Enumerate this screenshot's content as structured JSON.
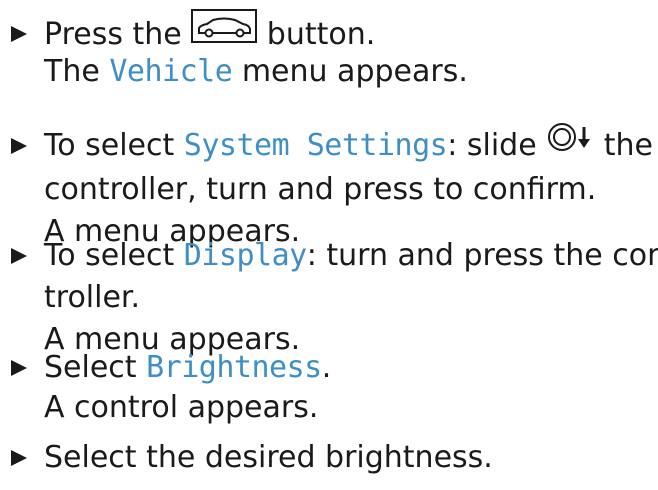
{
  "steps": [
    {
      "lines": [
        {
          "prefix": "Press the ",
          "icon": "car-icon",
          "suffix": " button."
        },
        {
          "text": "The ",
          "mono": "Vehicle",
          "after": " menu appears."
        }
      ]
    },
    {
      "lines": [
        {
          "text": "To select ",
          "mono": "System Settings",
          "after": ": slide ",
          "icon": "controller-slide-down-icon",
          "after2": " the"
        },
        {
          "text": "controller, turn and press to confirm."
        },
        {
          "text": "A menu appears."
        }
      ]
    },
    {
      "lines": [
        {
          "text": "To select ",
          "mono": "Display",
          "after": ": turn and press the con-"
        },
        {
          "text": "troller."
        },
        {
          "text": "A menu appears."
        }
      ]
    },
    {
      "lines": [
        {
          "text": "Select ",
          "mono": "Brightness",
          "after": "."
        },
        {
          "text": "A control appears."
        }
      ]
    },
    {
      "lines": [
        {
          "text": "Select the desired brightness."
        }
      ]
    }
  ],
  "colors": {
    "accent": "#3f8fc6",
    "text": "#1a1a1a"
  }
}
